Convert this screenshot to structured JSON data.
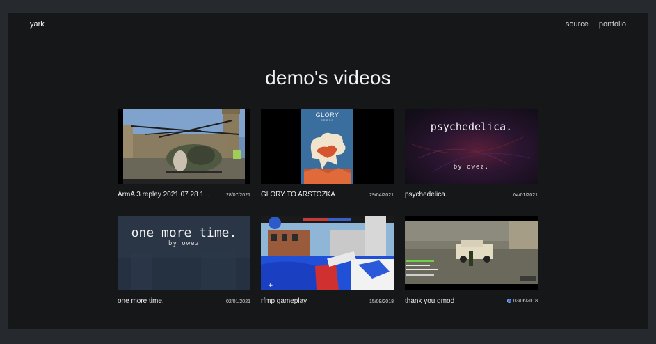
{
  "header": {
    "brand": "yark",
    "nav": [
      {
        "label": "source"
      },
      {
        "label": "portfolio"
      }
    ]
  },
  "page": {
    "title": "demo's videos"
  },
  "videos": [
    {
      "title": "ArmA 3 replay 2021 07 28 1...",
      "date": "28/07/2021"
    },
    {
      "title": "GLORY TO ARSTOZKA",
      "date": "29/04/2021",
      "thumb_text": {
        "top": "GLORY",
        "sub": "CROSS"
      }
    },
    {
      "title": "psychedelica.",
      "date": "04/01/2021",
      "thumb_text": {
        "main": "psychedelica.",
        "sub": "by owez."
      }
    },
    {
      "title": "one more time.",
      "date": "02/01/2021",
      "thumb_text": {
        "main": "one more time.",
        "sub": "by owez"
      }
    },
    {
      "title": "rfmp gameplay",
      "date": "15/09/2018"
    },
    {
      "title": "thank you gmod",
      "date": "03/06/2018",
      "icon": "blue-circle-icon"
    }
  ],
  "colors": {
    "background": "#161719",
    "outer": "#26292d",
    "text": "#e8e8e8"
  }
}
